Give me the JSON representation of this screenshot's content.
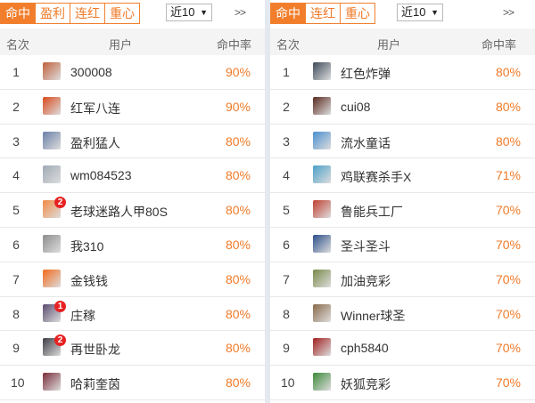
{
  "colors": {
    "accent": "#f27d2a",
    "rate": "#f07a28",
    "badge": "#e62222"
  },
  "left": {
    "tabs": [
      {
        "label": "命中",
        "active": true
      },
      {
        "label": "盈利"
      },
      {
        "label": "连红"
      },
      {
        "label": "重心"
      }
    ],
    "select": {
      "value": "近10"
    },
    "more": ">>",
    "header": {
      "rank": "名次",
      "user": "用户",
      "rate": "命中率"
    },
    "rows": [
      {
        "rank": "1",
        "name": "300008",
        "rate": "90%",
        "avatar_color": "#c0603a",
        "badge": ""
      },
      {
        "rank": "2",
        "name": "红军八连",
        "rate": "90%",
        "avatar_color": "#d94a1c",
        "badge": ""
      },
      {
        "rank": "3",
        "name": "盈利猛人",
        "rate": "80%",
        "avatar_color": "#6b7fa8",
        "badge": ""
      },
      {
        "rank": "4",
        "name": "wm084523",
        "rate": "80%",
        "avatar_color": "#9fa9b5",
        "badge": ""
      },
      {
        "rank": "5",
        "name": "老球迷路人甲80S",
        "rate": "80%",
        "avatar_color": "#f28a45",
        "badge": "2"
      },
      {
        "rank": "6",
        "name": "我310",
        "rate": "80%",
        "avatar_color": "#8d8d8d",
        "badge": ""
      },
      {
        "rank": "7",
        "name": "金钱钱",
        "rate": "80%",
        "avatar_color": "#f26a1b",
        "badge": ""
      },
      {
        "rank": "8",
        "name": "庄稼",
        "rate": "80%",
        "avatar_color": "#5a4c6e",
        "badge": "1"
      },
      {
        "rank": "9",
        "name": "再世卧龙",
        "rate": "80%",
        "avatar_color": "#3d3d45",
        "badge": "2"
      },
      {
        "rank": "10",
        "name": "哈莉奎茵",
        "rate": "80%",
        "avatar_color": "#7a2d3a",
        "badge": ""
      }
    ]
  },
  "right": {
    "tabs": [
      {
        "label": "命中",
        "active": true
      },
      {
        "label": "连红"
      },
      {
        "label": "重心"
      }
    ],
    "select": {
      "value": "近10"
    },
    "more": ">>",
    "header": {
      "rank": "名次",
      "user": "用户",
      "rate": "命中率"
    },
    "rows": [
      {
        "rank": "1",
        "name": "红色炸弹",
        "rate": "80%",
        "avatar_color": "#3d4a5a",
        "badge": ""
      },
      {
        "rank": "2",
        "name": "cui08",
        "rate": "80%",
        "avatar_color": "#5a2a20",
        "badge": ""
      },
      {
        "rank": "3",
        "name": "流水童话",
        "rate": "80%",
        "avatar_color": "#4a8ed0",
        "badge": ""
      },
      {
        "rank": "4",
        "name": "鸡联赛杀手X",
        "rate": "71%",
        "avatar_color": "#4aa0c8",
        "badge": ""
      },
      {
        "rank": "5",
        "name": "鲁能兵工厂",
        "rate": "70%",
        "avatar_color": "#c04030",
        "badge": ""
      },
      {
        "rank": "6",
        "name": "圣斗圣斗",
        "rate": "70%",
        "avatar_color": "#2b4f8a",
        "badge": ""
      },
      {
        "rank": "7",
        "name": "加油竞彩",
        "rate": "70%",
        "avatar_color": "#7a8a4a",
        "badge": ""
      },
      {
        "rank": "8",
        "name": "Winner球圣",
        "rate": "70%",
        "avatar_color": "#8a6a4a",
        "badge": ""
      },
      {
        "rank": "9",
        "name": "cph5840",
        "rate": "70%",
        "avatar_color": "#a02020",
        "badge": ""
      },
      {
        "rank": "10",
        "name": "妖狐竞彩",
        "rate": "70%",
        "avatar_color": "#3d8a3a",
        "badge": ""
      }
    ]
  }
}
